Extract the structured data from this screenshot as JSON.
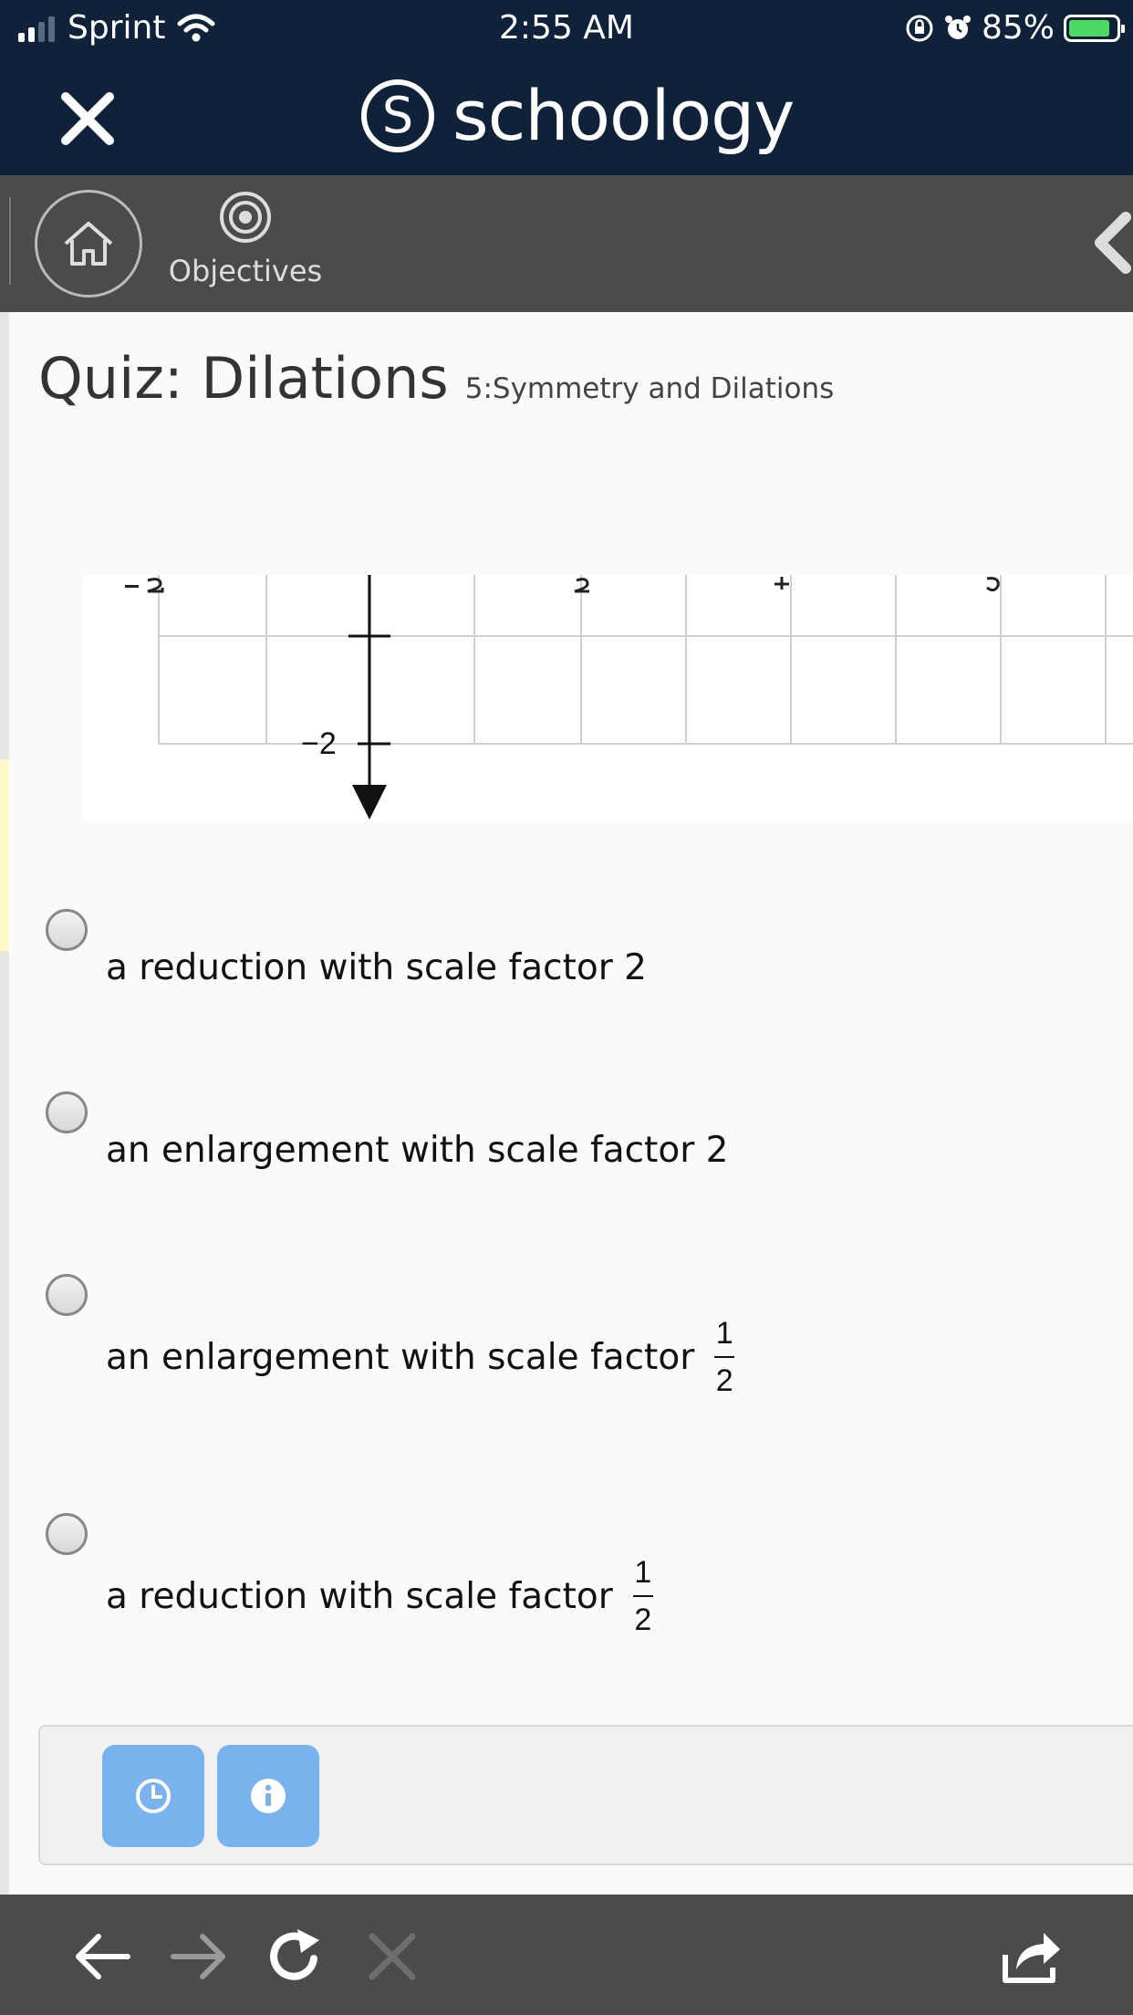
{
  "status_bar": {
    "carrier": "Sprint",
    "time": "2:55 AM",
    "battery": "85%",
    "battery_level": 0.85
  },
  "app_bar": {
    "brand": "schoology",
    "logo_letter": "S"
  },
  "toolbar": {
    "objectives_label": "Objectives"
  },
  "quiz": {
    "title": "Quiz: Dilations",
    "subtitle": "5:Symmetry and Dilations"
  },
  "graph": {
    "y_tick_label": "−2"
  },
  "options": [
    {
      "text": "a reduction with scale factor 2",
      "fraction": null
    },
    {
      "text": "an enlargement with scale factor 2",
      "fraction": null
    },
    {
      "text": "an enlargement with scale factor",
      "fraction": {
        "numerator": "1",
        "denominator": "2"
      }
    },
    {
      "text": "a reduction with scale factor",
      "fraction": {
        "numerator": "1",
        "denominator": "2"
      }
    }
  ],
  "icons": [
    "close-icon",
    "home-icon",
    "objectives-icon",
    "chevron-left-icon",
    "clock-icon",
    "info-icon",
    "back-arrow-icon",
    "forward-arrow-icon",
    "refresh-icon",
    "stop-icon",
    "share-icon"
  ],
  "colors": {
    "header": "#0f2239",
    "toolbar": "#4b4b4b",
    "tool_button": "#79b3ee",
    "battery_fill": "#4cd964"
  }
}
